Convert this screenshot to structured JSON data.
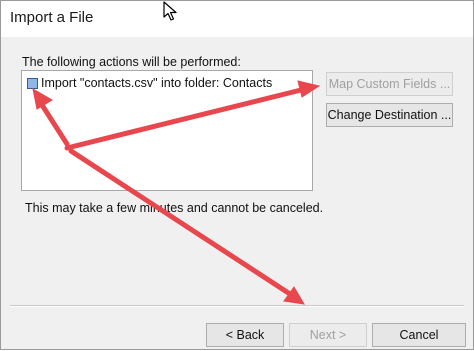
{
  "window": {
    "title": "Import a File"
  },
  "actions": {
    "label": "The following actions will be performed:",
    "items": [
      {
        "label": "Import \"contacts.csv\" into folder: Contacts",
        "icon": "action-item-icon"
      }
    ]
  },
  "buttons": {
    "map_custom_fields": "Map Custom Fields ...",
    "change_destination": "Change Destination ...",
    "back": "< Back",
    "next": "Next >",
    "cancel": "Cancel"
  },
  "note": "This may take a few minutes and cannot be canceled.",
  "colors": {
    "annotation_arrow": "#e8474d",
    "item_icon_fill": "#8fb6e6"
  }
}
